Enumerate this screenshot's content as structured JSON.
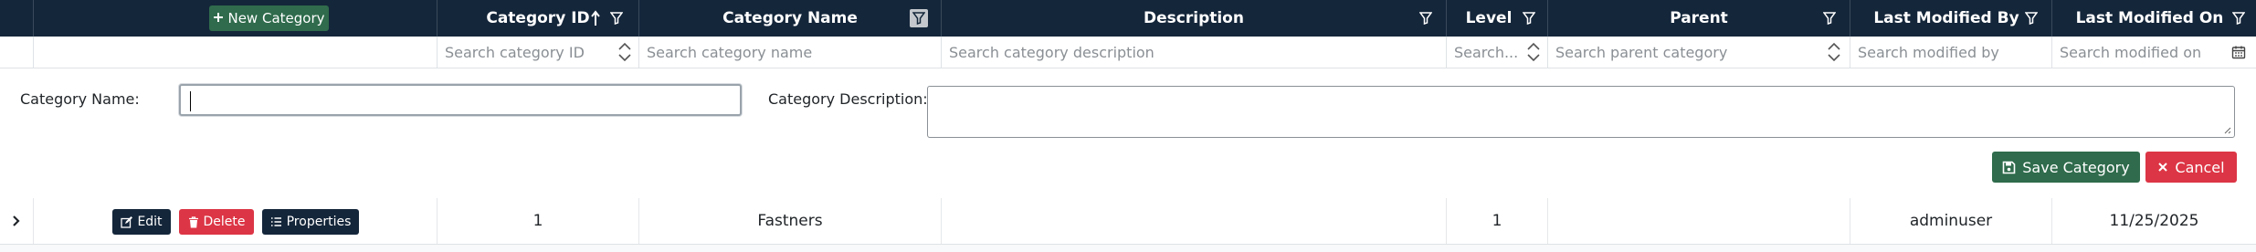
{
  "toolbar": {
    "new_category_label": "New Category"
  },
  "columns": [
    {
      "key": "category_id",
      "label": "Category ID",
      "placeholder": "Search category ID"
    },
    {
      "key": "category_name",
      "label": "Category Name",
      "placeholder": "Search category name"
    },
    {
      "key": "description",
      "label": "Description",
      "placeholder": "Search category description"
    },
    {
      "key": "level",
      "label": "Level",
      "placeholder": "Search..."
    },
    {
      "key": "parent",
      "label": "Parent",
      "placeholder": "Search parent category"
    },
    {
      "key": "last_modified_by",
      "label": "Last Modified By",
      "placeholder": "Search modified by"
    },
    {
      "key": "last_modified_on",
      "label": "Last Modified On",
      "placeholder": "Search modified on"
    }
  ],
  "form": {
    "category_name_label": "Category Name:",
    "category_name_value": "",
    "category_description_label": "Category Description:",
    "category_description_value": "",
    "save_label": "Save Category",
    "cancel_label": "Cancel"
  },
  "row_actions": {
    "edit_label": "Edit",
    "delete_label": "Delete",
    "properties_label": "Properties"
  },
  "rows": [
    {
      "category_id": "1",
      "category_name": "Fastners",
      "description": "",
      "level": "1",
      "parent": "",
      "last_modified_by": "adminuser",
      "last_modified_on": "11/25/2025"
    }
  ],
  "colors": {
    "header_bg": "#14263a",
    "save_green": "#2f6b4c",
    "cancel_red": "#dc3545"
  },
  "icons": [
    "plus-icon",
    "sort-asc-icon",
    "filter-icon",
    "spinner-icon",
    "calendar-icon",
    "save-icon",
    "close-icon",
    "chevron-right-icon",
    "edit-icon",
    "trash-icon",
    "list-icon"
  ]
}
